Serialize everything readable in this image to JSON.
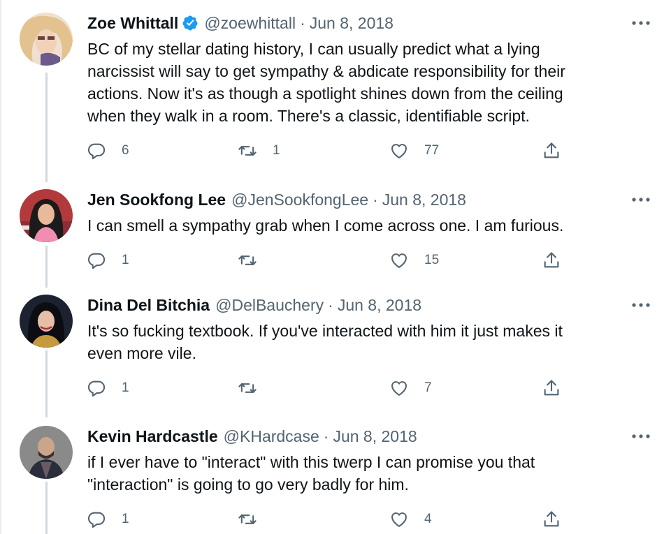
{
  "tweets": [
    {
      "name": "Zoe Whittall",
      "verified": true,
      "handle": "@zoewhittall",
      "separator": "·",
      "date": "Jun 8, 2018",
      "text_lines": [
        "BC of my stellar dating history, I can usually predict what a lying",
        "narcissist will say to get sympathy & abdicate responsibility for their",
        "actions. Now it's as though a spotlight shines down from the ceiling",
        "when they walk in a room. There's a classic, identifiable script."
      ],
      "replies": "6",
      "retweets": "1",
      "likes": "77",
      "avatar_colors": [
        "#e9c9a8",
        "#f3e1c8",
        "#6b5a8c"
      ]
    },
    {
      "name": "Jen Sookfong Lee",
      "verified": false,
      "handle": "@JenSookfongLee",
      "separator": "·",
      "date": "Jun 8, 2018",
      "text_lines": [
        "I can smell a sympathy grab when I come across one. I am furious."
      ],
      "replies": "1",
      "retweets": "",
      "likes": "15",
      "avatar_colors": [
        "#b23a3a",
        "#1b1b1b",
        "#f08db0"
      ]
    },
    {
      "name": "Dina Del Bitchia",
      "verified": false,
      "handle": "@DelBauchery",
      "separator": "·",
      "date": "Jun 8, 2018",
      "text_lines": [
        "It's so fucking textbook. If you've interacted with him it just makes it",
        "even more vile."
      ],
      "replies": "1",
      "retweets": "",
      "likes": "7",
      "avatar_colors": [
        "#1c2230",
        "#0c0d12",
        "#c59a3e"
      ]
    },
    {
      "name": "Kevin Hardcastle",
      "verified": false,
      "handle": "@KHardcase",
      "separator": "·",
      "date": "Jun 8, 2018",
      "text_lines": [
        "if I ever have to \"interact\" with this twerp I can promise you that",
        "\"interaction\" is going to go very badly for him."
      ],
      "replies": "1",
      "retweets": "",
      "likes": "4",
      "avatar_colors": [
        "#8a8a8a",
        "#3b2f2a",
        "#2a2d3a"
      ]
    }
  ],
  "colors": {
    "text": "#0f1419",
    "secondary": "#536471",
    "verified": "#1d9bf0",
    "thread_line": "#cfd9de"
  },
  "icons": {
    "reply": "reply-icon",
    "retweet": "retweet-icon",
    "like": "like-icon",
    "share": "share-icon",
    "more": "more-icon",
    "verified": "verified-badge-icon"
  }
}
